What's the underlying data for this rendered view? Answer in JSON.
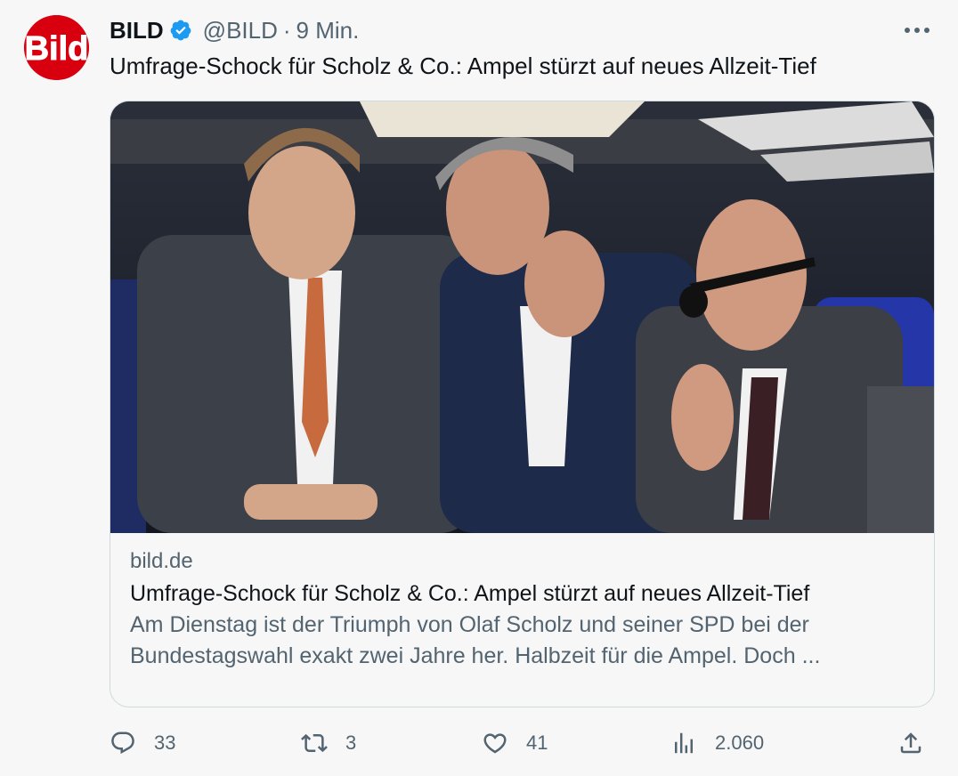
{
  "tweet": {
    "author_name": "BILD",
    "logo_text": "Bild",
    "handle": "@BILD",
    "separator": "·",
    "time": "9 Min.",
    "text": "Umfrage-Schock für Scholz & Co.: Ampel stürzt auf neues Allzeit-Tief",
    "more_label": "···"
  },
  "card": {
    "domain": "bild.de",
    "title": "Umfrage-Schock für Scholz & Co.: Ampel stürzt auf neues Allzeit-Tief",
    "description": "Am Dienstag ist der Triumph von Olaf Scholz und seiner SPD bei der Bundestagswahl exakt zwei Jahre her. Halbzeit für die Ampel. Doch ...",
    "image_icon": "news-photo"
  },
  "actions": {
    "replies": "33",
    "retweets": "3",
    "likes": "41",
    "views": "2.060"
  },
  "colors": {
    "brand_red": "#d8000f",
    "verified_blue": "#1d9bf0",
    "secondary_text": "#536471",
    "primary_text": "#0f1419",
    "border": "#cfd9de"
  }
}
